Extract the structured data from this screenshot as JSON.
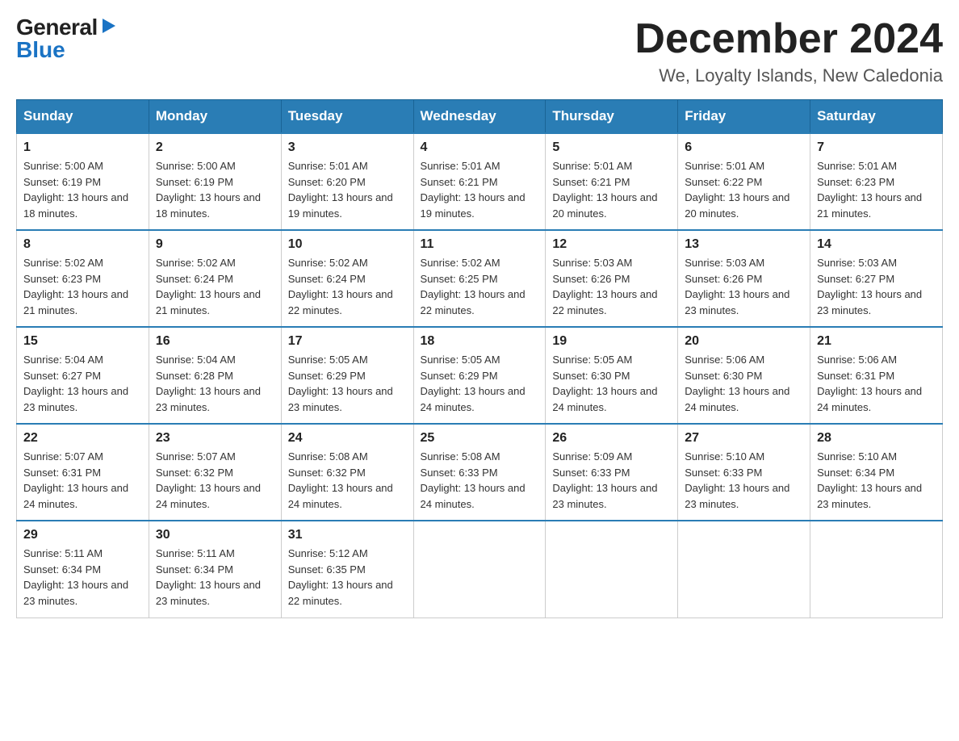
{
  "logo": {
    "general": "General",
    "blue": "Blue"
  },
  "header": {
    "month": "December 2024",
    "location": "We, Loyalty Islands, New Caledonia"
  },
  "weekdays": [
    "Sunday",
    "Monday",
    "Tuesday",
    "Wednesday",
    "Thursday",
    "Friday",
    "Saturday"
  ],
  "weeks": [
    [
      {
        "day": "1",
        "sunrise": "5:00 AM",
        "sunset": "6:19 PM",
        "daylight": "13 hours and 18 minutes."
      },
      {
        "day": "2",
        "sunrise": "5:00 AM",
        "sunset": "6:19 PM",
        "daylight": "13 hours and 18 minutes."
      },
      {
        "day": "3",
        "sunrise": "5:01 AM",
        "sunset": "6:20 PM",
        "daylight": "13 hours and 19 minutes."
      },
      {
        "day": "4",
        "sunrise": "5:01 AM",
        "sunset": "6:21 PM",
        "daylight": "13 hours and 19 minutes."
      },
      {
        "day": "5",
        "sunrise": "5:01 AM",
        "sunset": "6:21 PM",
        "daylight": "13 hours and 20 minutes."
      },
      {
        "day": "6",
        "sunrise": "5:01 AM",
        "sunset": "6:22 PM",
        "daylight": "13 hours and 20 minutes."
      },
      {
        "day": "7",
        "sunrise": "5:01 AM",
        "sunset": "6:23 PM",
        "daylight": "13 hours and 21 minutes."
      }
    ],
    [
      {
        "day": "8",
        "sunrise": "5:02 AM",
        "sunset": "6:23 PM",
        "daylight": "13 hours and 21 minutes."
      },
      {
        "day": "9",
        "sunrise": "5:02 AM",
        "sunset": "6:24 PM",
        "daylight": "13 hours and 21 minutes."
      },
      {
        "day": "10",
        "sunrise": "5:02 AM",
        "sunset": "6:24 PM",
        "daylight": "13 hours and 22 minutes."
      },
      {
        "day": "11",
        "sunrise": "5:02 AM",
        "sunset": "6:25 PM",
        "daylight": "13 hours and 22 minutes."
      },
      {
        "day": "12",
        "sunrise": "5:03 AM",
        "sunset": "6:26 PM",
        "daylight": "13 hours and 22 minutes."
      },
      {
        "day": "13",
        "sunrise": "5:03 AM",
        "sunset": "6:26 PM",
        "daylight": "13 hours and 23 minutes."
      },
      {
        "day": "14",
        "sunrise": "5:03 AM",
        "sunset": "6:27 PM",
        "daylight": "13 hours and 23 minutes."
      }
    ],
    [
      {
        "day": "15",
        "sunrise": "5:04 AM",
        "sunset": "6:27 PM",
        "daylight": "13 hours and 23 minutes."
      },
      {
        "day": "16",
        "sunrise": "5:04 AM",
        "sunset": "6:28 PM",
        "daylight": "13 hours and 23 minutes."
      },
      {
        "day": "17",
        "sunrise": "5:05 AM",
        "sunset": "6:29 PM",
        "daylight": "13 hours and 23 minutes."
      },
      {
        "day": "18",
        "sunrise": "5:05 AM",
        "sunset": "6:29 PM",
        "daylight": "13 hours and 24 minutes."
      },
      {
        "day": "19",
        "sunrise": "5:05 AM",
        "sunset": "6:30 PM",
        "daylight": "13 hours and 24 minutes."
      },
      {
        "day": "20",
        "sunrise": "5:06 AM",
        "sunset": "6:30 PM",
        "daylight": "13 hours and 24 minutes."
      },
      {
        "day": "21",
        "sunrise": "5:06 AM",
        "sunset": "6:31 PM",
        "daylight": "13 hours and 24 minutes."
      }
    ],
    [
      {
        "day": "22",
        "sunrise": "5:07 AM",
        "sunset": "6:31 PM",
        "daylight": "13 hours and 24 minutes."
      },
      {
        "day": "23",
        "sunrise": "5:07 AM",
        "sunset": "6:32 PM",
        "daylight": "13 hours and 24 minutes."
      },
      {
        "day": "24",
        "sunrise": "5:08 AM",
        "sunset": "6:32 PM",
        "daylight": "13 hours and 24 minutes."
      },
      {
        "day": "25",
        "sunrise": "5:08 AM",
        "sunset": "6:33 PM",
        "daylight": "13 hours and 24 minutes."
      },
      {
        "day": "26",
        "sunrise": "5:09 AM",
        "sunset": "6:33 PM",
        "daylight": "13 hours and 23 minutes."
      },
      {
        "day": "27",
        "sunrise": "5:10 AM",
        "sunset": "6:33 PM",
        "daylight": "13 hours and 23 minutes."
      },
      {
        "day": "28",
        "sunrise": "5:10 AM",
        "sunset": "6:34 PM",
        "daylight": "13 hours and 23 minutes."
      }
    ],
    [
      {
        "day": "29",
        "sunrise": "5:11 AM",
        "sunset": "6:34 PM",
        "daylight": "13 hours and 23 minutes."
      },
      {
        "day": "30",
        "sunrise": "5:11 AM",
        "sunset": "6:34 PM",
        "daylight": "13 hours and 23 minutes."
      },
      {
        "day": "31",
        "sunrise": "5:12 AM",
        "sunset": "6:35 PM",
        "daylight": "13 hours and 22 minutes."
      },
      null,
      null,
      null,
      null
    ]
  ]
}
